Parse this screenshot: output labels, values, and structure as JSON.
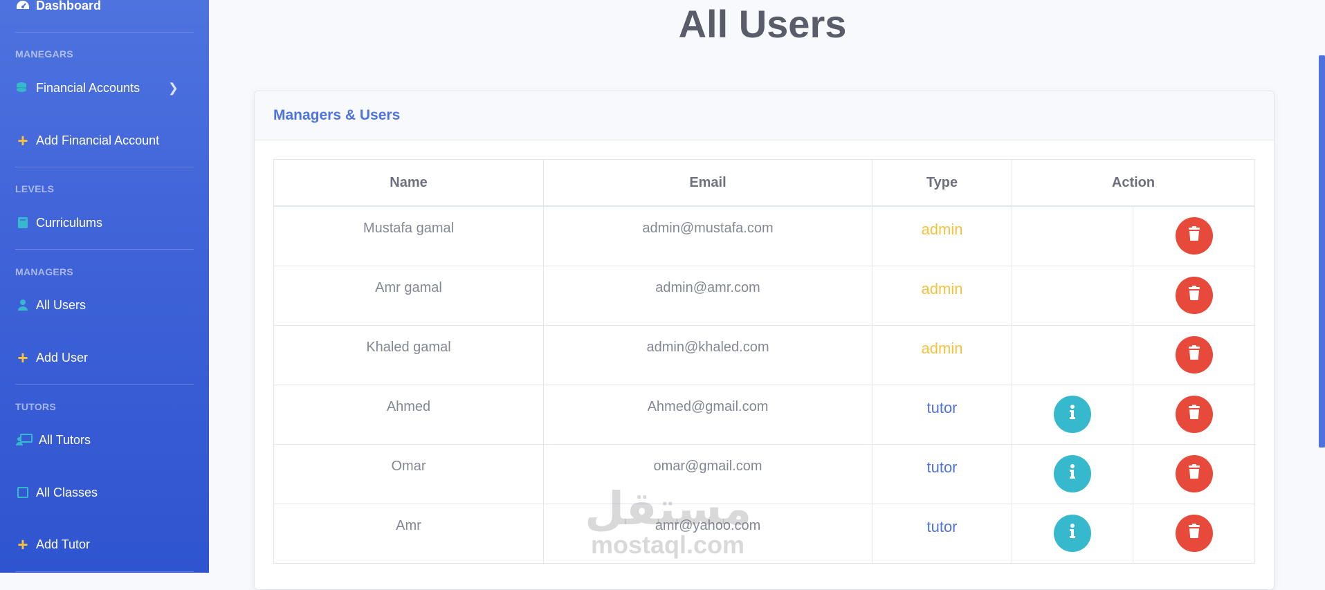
{
  "sidebar": {
    "dashboard": "Dashboard",
    "section_manegars": "MANEGARS",
    "financial_accounts": "Financial Accounts",
    "add_financial_account": "Add Financial Account",
    "section_levels": "LEVELS",
    "curriculums": "Curriculums",
    "section_managers": "MANAGERS",
    "all_users": "All Users",
    "add_user": "Add User",
    "section_tutors": "TUTORS",
    "all_tutors": "All Tutors",
    "all_classes": "All Classes",
    "add_tutor": "Add Tutor"
  },
  "page": {
    "title": "All Users"
  },
  "card": {
    "title": "Managers & Users",
    "headers": [
      "Name",
      "Email",
      "Type",
      "Action"
    ],
    "rows": [
      {
        "name": "Mustafa gamal",
        "email": "admin@mustafa.com",
        "type": "admin",
        "has_info": false
      },
      {
        "name": "Amr gamal",
        "email": "admin@amr.com",
        "type": "admin",
        "has_info": false
      },
      {
        "name": "Khaled gamal",
        "email": "admin@khaled.com",
        "type": "admin",
        "has_info": false
      },
      {
        "name": "Ahmed",
        "email": "Ahmed@gmail.com",
        "type": "tutor",
        "has_info": true
      },
      {
        "name": "Omar",
        "email": "omar@gmail.com",
        "type": "tutor",
        "has_info": true
      },
      {
        "name": "Amr",
        "email": "amr@yahoo.com",
        "type": "tutor",
        "has_info": true
      }
    ]
  },
  "watermark": {
    "arabic": "مستقل",
    "latin": "mostaql.com"
  },
  "colors": {
    "primary": "#4e73df",
    "warning": "#f6c23e",
    "danger": "#e74a3b",
    "info": "#36b9cc",
    "sidebar_icon": "#36b9cc"
  },
  "icons": {
    "dashboard": "tachometer-icon",
    "financial": "coins-icon",
    "curriculums": "book-icon",
    "users": "user-tie-icon",
    "tutors": "chalkboard-teacher-icon",
    "classes": "square-icon",
    "add": "plus-icon",
    "delete": "trash-icon",
    "info": "info-icon"
  }
}
